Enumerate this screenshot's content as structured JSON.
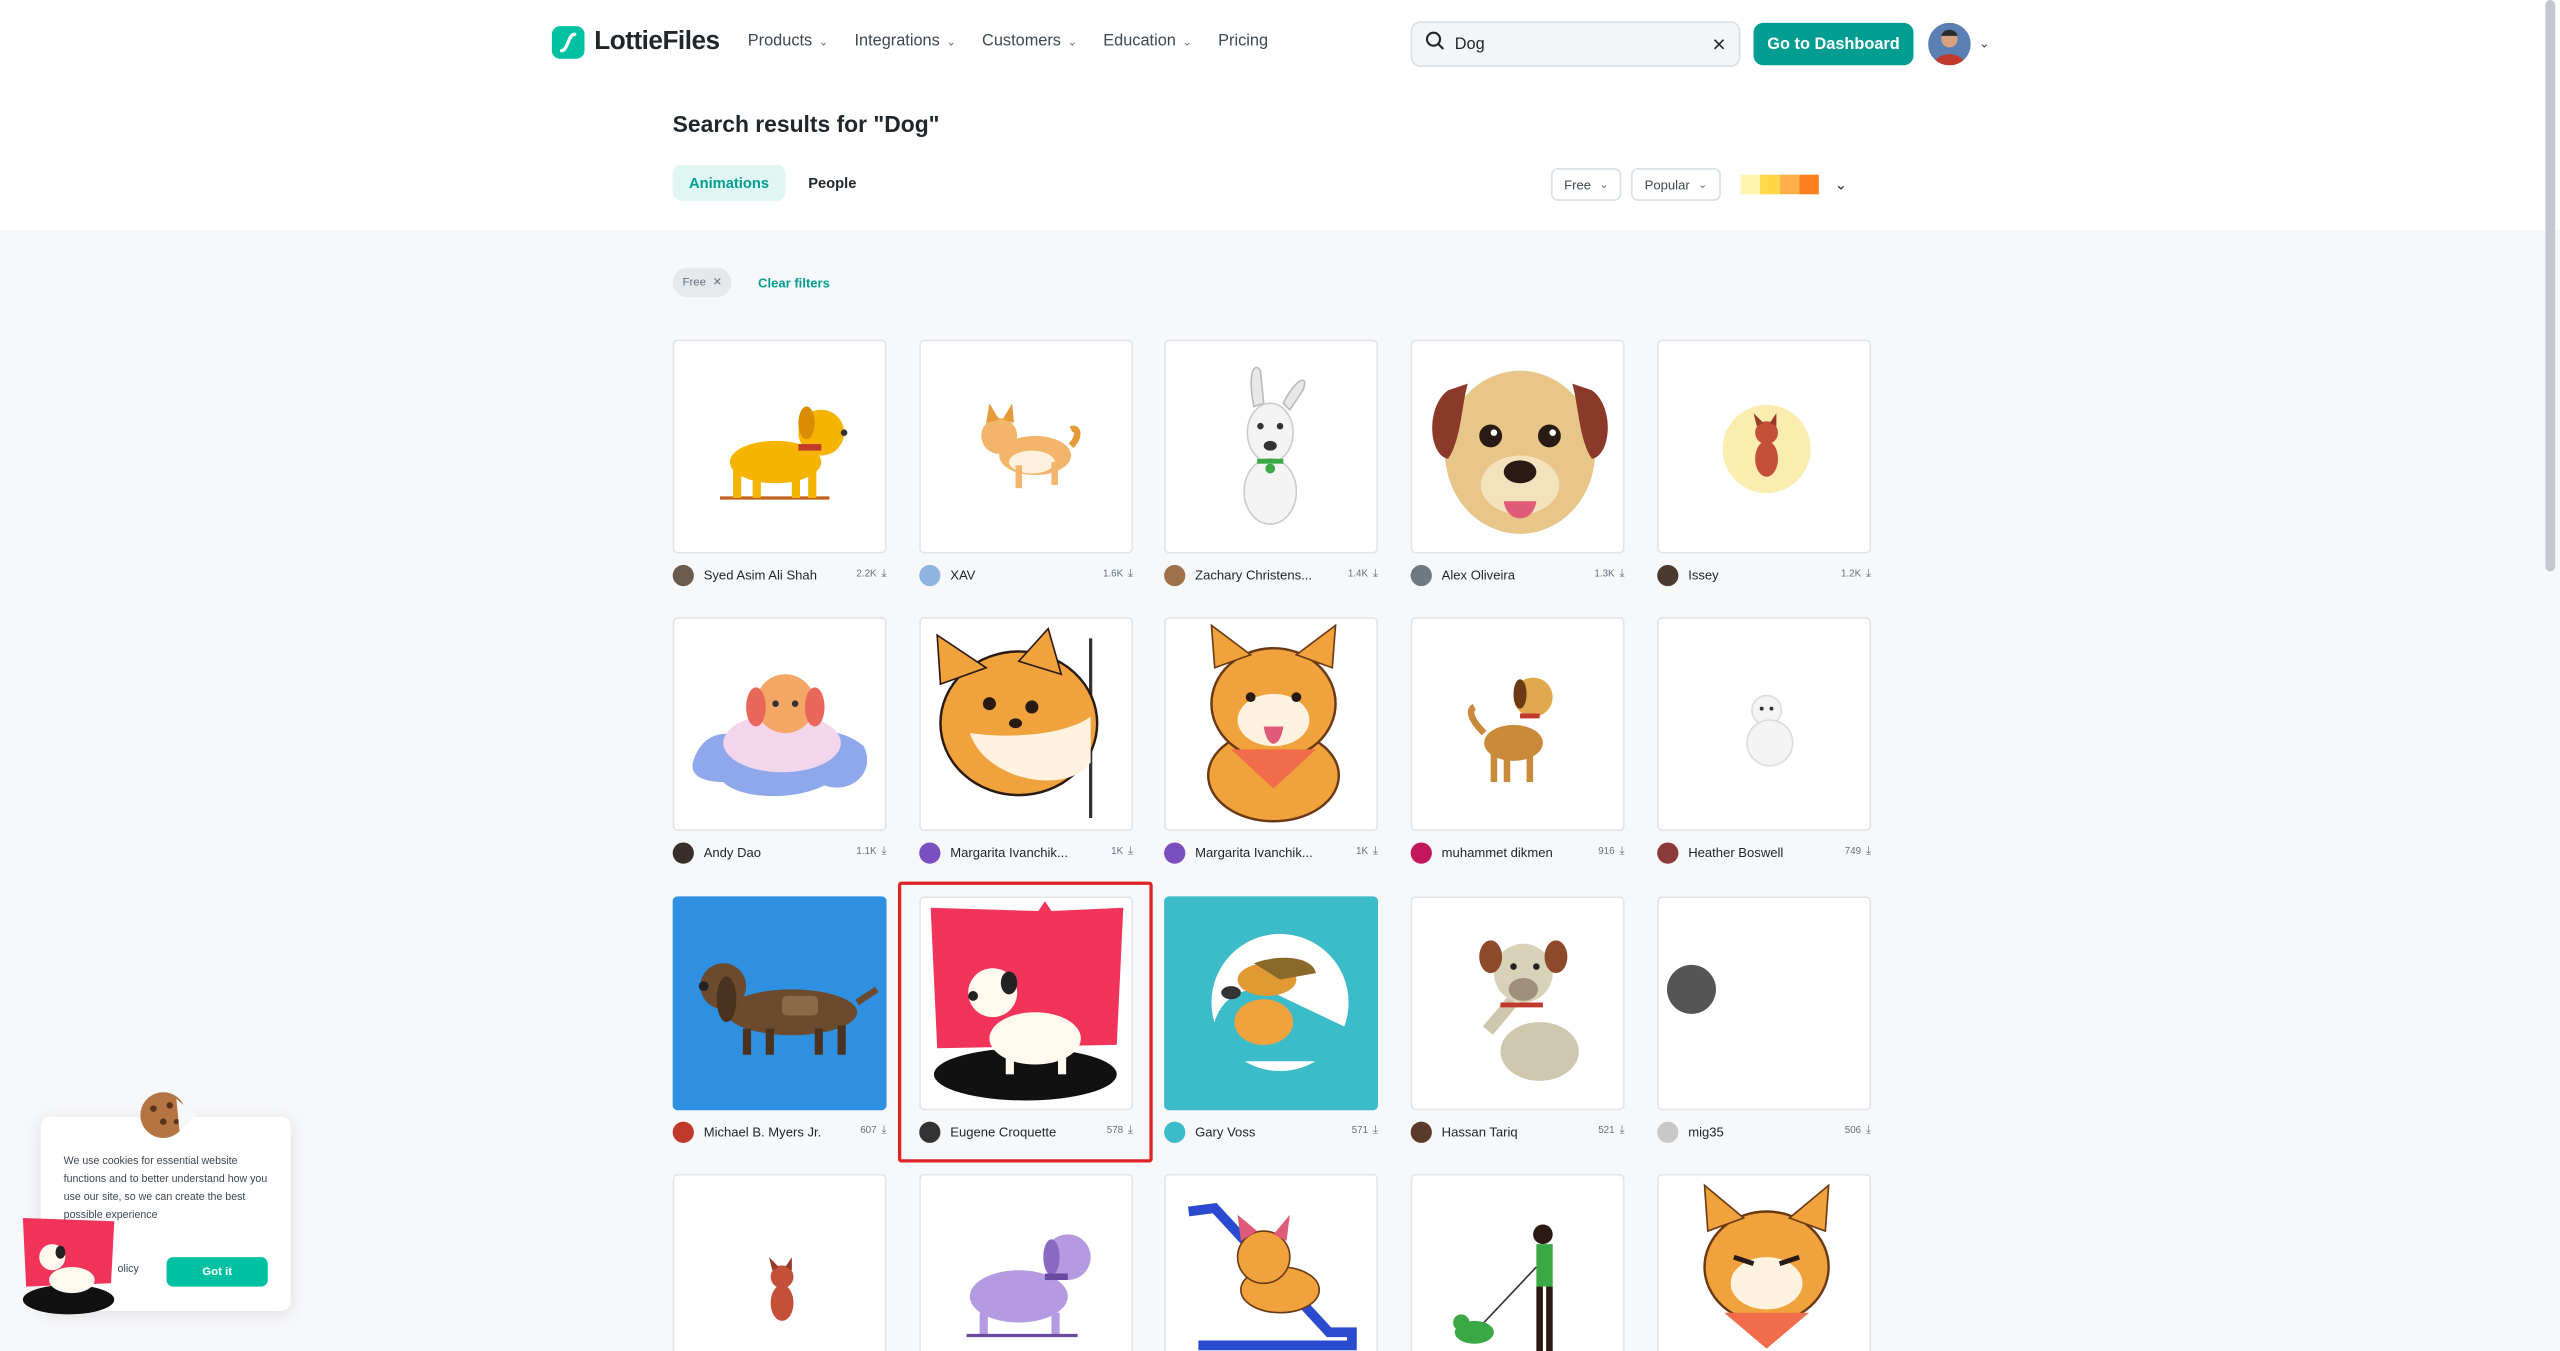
{
  "header": {
    "logo_text": "LottieFiles",
    "nav": [
      "Products",
      "Integrations",
      "Customers",
      "Education",
      "Pricing"
    ],
    "search_value": "Dog",
    "dashboard_button": "Go to Dashboard"
  },
  "main": {
    "title": "Search results for \"Dog\"",
    "tabs": [
      "Animations",
      "People"
    ],
    "filter_license": "Free",
    "filter_sort": "Popular",
    "palette_colors": [
      "#fff3b0",
      "#ffd84a",
      "#ffb04a",
      "#ff7f1f"
    ],
    "active_chip": "Free",
    "clear_filters": "Clear filters"
  },
  "cards": [
    {
      "author": "Syed Asim Ali Shah",
      "count": "2.2K"
    },
    {
      "author": "XAV",
      "count": "1.6K"
    },
    {
      "author": "Zachary Christens...",
      "count": "1.4K"
    },
    {
      "author": "Alex Oliveira",
      "count": "1.3K"
    },
    {
      "author": "Issey",
      "count": "1.2K"
    },
    {
      "author": "Andy Dao",
      "count": "1.1K"
    },
    {
      "author": "Margarita Ivanchik...",
      "count": "1K"
    },
    {
      "author": "Margarita Ivanchik...",
      "count": "1K"
    },
    {
      "author": "muhammet dikmen",
      "count": "916"
    },
    {
      "author": "Heather Boswell",
      "count": "749"
    },
    {
      "author": "Michael B. Myers Jr.",
      "count": "607"
    },
    {
      "author": "Eugene Croquette",
      "count": "578"
    },
    {
      "author": "Gary Voss",
      "count": "571"
    },
    {
      "author": "Hassan Tariq",
      "count": "521"
    },
    {
      "author": "mig35",
      "count": "506"
    }
  ],
  "cookie": {
    "text": "We use cookies for essential website functions and to better understand how you use our site, so we can create the best possible experience",
    "link": "olicy",
    "button": "Got it"
  }
}
